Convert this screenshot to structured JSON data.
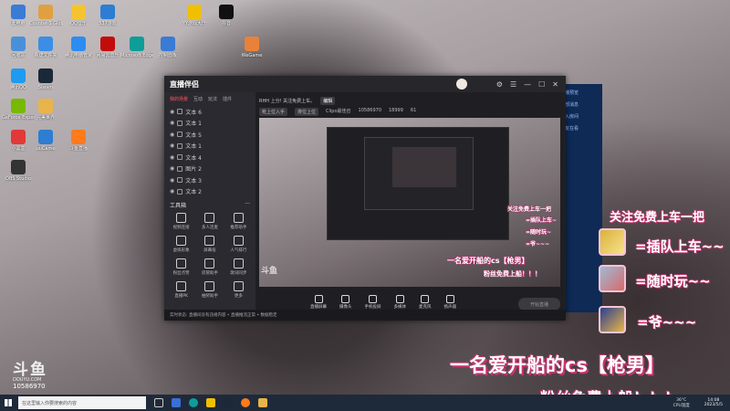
{
  "desktop": {
    "icons": [
      {
        "label": "此电脑",
        "icon": "computer-icon",
        "color": "#3a7bd5"
      },
      {
        "label": "Counter-S Global Off...",
        "icon": "cs-icon",
        "color": "#e0a040"
      },
      {
        "label": "QQ音乐",
        "icon": "qq-music-icon",
        "color": "#f4c430"
      },
      {
        "label": "537游戏",
        "icon": "game-icon",
        "color": "#2d7dd2"
      },
      {
        "label": "YY游戏大厅",
        "icon": "yy-icon",
        "color": "#f0c000"
      },
      {
        "label": "抖音",
        "icon": "douyin-icon",
        "color": "#111111"
      },
      {
        "label": "回收站",
        "icon": "recycle-bin-icon",
        "color": "#4a90d9"
      },
      {
        "label": "新建文件夹",
        "icon": "folder-icon",
        "color": "#3a8ee6"
      },
      {
        "label": "腾讯电脑管家",
        "icon": "tencent-manager-icon",
        "color": "#2d8cf0"
      },
      {
        "label": "网易云音乐",
        "icon": "netease-music-icon",
        "color": "#c20c0c"
      },
      {
        "label": "Microsoft Edge",
        "icon": "edge-icon",
        "color": "#0f9d9a"
      },
      {
        "label": "控制面板",
        "icon": "control-panel-icon",
        "color": "#3a7bd5"
      },
      {
        "label": "WeGame",
        "icon": "wegame-icon",
        "color": "#e8823a"
      },
      {
        "label": "腾讯QQ",
        "icon": "qq-icon",
        "color": "#1d9bf0"
      },
      {
        "label": "Steam",
        "icon": "steam-icon",
        "color": "#1b2838"
      },
      {
        "label": "GeForce Experience",
        "icon": "geforce-icon",
        "color": "#76b900"
      },
      {
        "label": "完美世界",
        "icon": "perfect-world-icon",
        "color": "#e8b44a"
      },
      {
        "label": "小黑盒",
        "icon": "heybox-icon",
        "color": "#e23838"
      },
      {
        "label": "uuCame",
        "icon": "uu-icon",
        "color": "#2d7dd2"
      },
      {
        "label": "斗鱼直播",
        "icon": "douyu-icon",
        "color": "#ff7a1a"
      },
      {
        "label": "OBS Studio",
        "icon": "obs-icon",
        "color": "#333333"
      }
    ]
  },
  "app": {
    "logo": "直播伴侣",
    "tabs": [
      "我的场景",
      "互动",
      "玩法",
      "插件"
    ],
    "scenes": [
      "文本 6",
      "文本 1",
      "文本 5",
      "文本 1",
      "文本 4",
      "图片 2",
      "文本 3",
      "文本 2"
    ],
    "tools_title": "工具箱",
    "tools_more": "···",
    "tools": [
      "视频连接",
      "多人连麦",
      "推荐助手",
      "虚拟形象",
      "屏幕投",
      "人气排行",
      "粉丝点赞",
      "房管助手",
      "歌词同步",
      "直播PK",
      "抽奖助手",
      "更多"
    ],
    "live_info": {
      "title": "RHH 上分! 关注免费上车。",
      "edit": "编辑",
      "category": "枪上位入手",
      "rank": "排位上位",
      "mode": "Clipo最佳召",
      "viewers": "10586970",
      "fans": "18999",
      "likes": "61"
    },
    "preview_overlays": [
      "关注免费上车一把",
      "=插队上车~",
      "=随时玩~",
      "=爷~~~",
      "一名爱开船的cs【枪男】",
      "粉丝免费上船！！！"
    ],
    "preview_watermark": "斗鱼",
    "controls": [
      "直播屏幕",
      "摄像头",
      "手机投屏",
      "多媒体",
      "麦克风",
      "扬声器"
    ],
    "start_button": "开始直播",
    "status_bar": "实时状态: 直播间没有违规内容 • 直播推流正常 • 数据稳定"
  },
  "background_window": {
    "items": [
      "直播预览",
      "全部消息",
      "进入房间",
      "好友在看"
    ]
  },
  "overlay": {
    "line1": "关注免费上车一把",
    "line2": "=插队上车~~",
    "line3": "=随时玩~~",
    "line4": "=爷~~~",
    "line5": "一名爱开船的cs【枪男】",
    "line6": "粉丝免费上船！！！"
  },
  "douyu": {
    "mark": "斗鱼",
    "sub": "DOUYU.COM",
    "room": "10586970"
  },
  "taskbar": {
    "search_placeholder": "在这里输入你要搜索的内容",
    "weather_temp": "36°C",
    "weather_label": "CPU温度",
    "time": "14:08",
    "date": "2023/5/5"
  }
}
